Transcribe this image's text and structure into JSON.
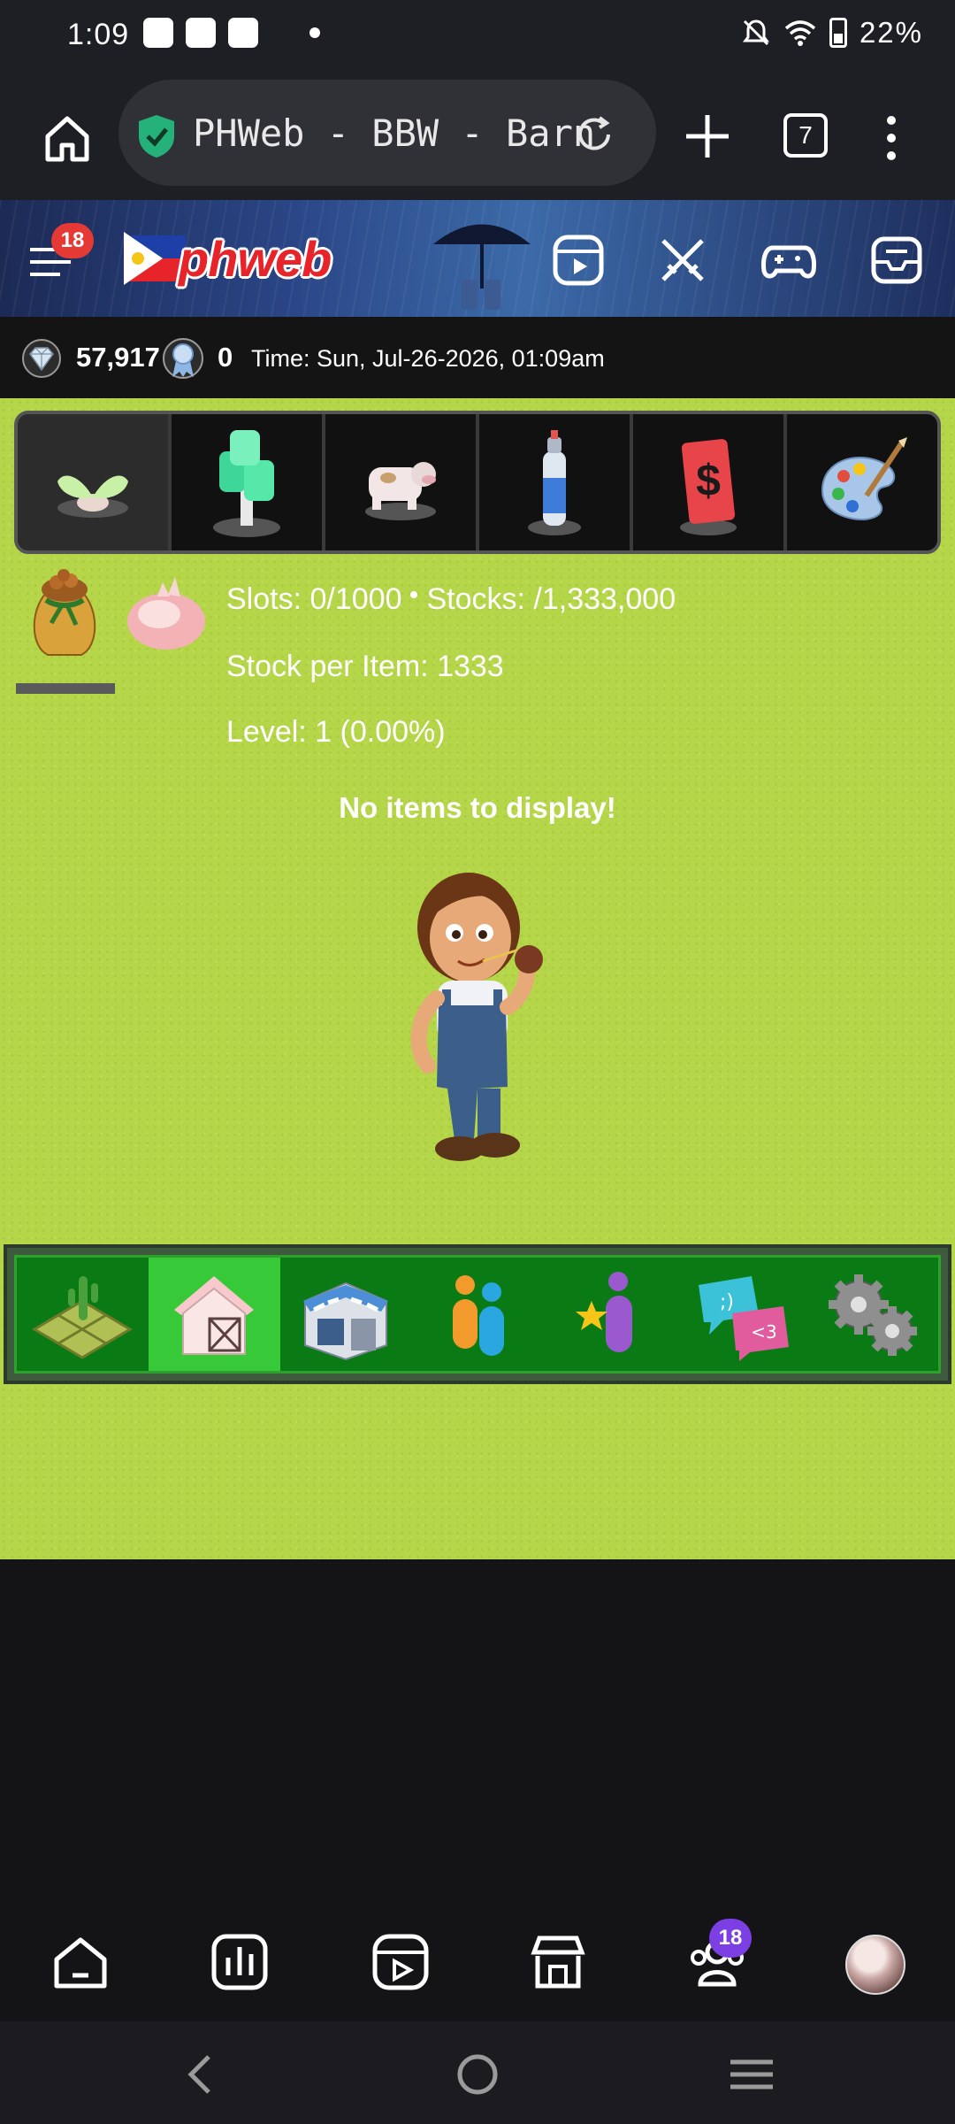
{
  "status_bar": {
    "time": "1:09",
    "battery": "22%",
    "icons": [
      "shopping-bag-icon",
      "app-icon",
      "mail-icon",
      "dot-icon",
      "mute-icon",
      "wifi-icon",
      "battery-icon"
    ]
  },
  "browser": {
    "url_title": "PHWeb - BBW - Barn",
    "tab_count": "7"
  },
  "site_header": {
    "logo": "phweb",
    "menu_badge": "18"
  },
  "stats": {
    "gems": "57,917",
    "ribbons": "0",
    "time": "Time: Sun, Jul-26-2026, 01:09am"
  },
  "barn": {
    "slots": "Slots: 0/1000",
    "stocks": "Stocks: /1,333,000",
    "stock_per_item": "Stock per Item: 1333",
    "level": "Level: 1 (0.00%)",
    "empty_message": "No items to display!"
  },
  "top_menu": [
    {
      "name": "seedling-tab",
      "active": true
    },
    {
      "name": "tree-tab",
      "active": false
    },
    {
      "name": "cow-tab",
      "active": false
    },
    {
      "name": "spray-can-tab",
      "active": false
    },
    {
      "name": "dollar-card-tab",
      "active": false
    },
    {
      "name": "palette-tab",
      "active": false
    }
  ],
  "game_nav": [
    {
      "name": "farm",
      "active": false
    },
    {
      "name": "barn",
      "active": true
    },
    {
      "name": "shop",
      "active": false
    },
    {
      "name": "neighbors",
      "active": false
    },
    {
      "name": "favorites",
      "active": false
    },
    {
      "name": "messages",
      "active": false
    },
    {
      "name": "settings",
      "active": false
    }
  ],
  "app_nav": {
    "groups_badge": "18"
  },
  "colors": {
    "grass": "#b6d64a",
    "nav_green": "#0a7a14",
    "nav_active": "#37c937",
    "badge_red": "#e53935",
    "badge_purple": "#7b3fe4"
  }
}
